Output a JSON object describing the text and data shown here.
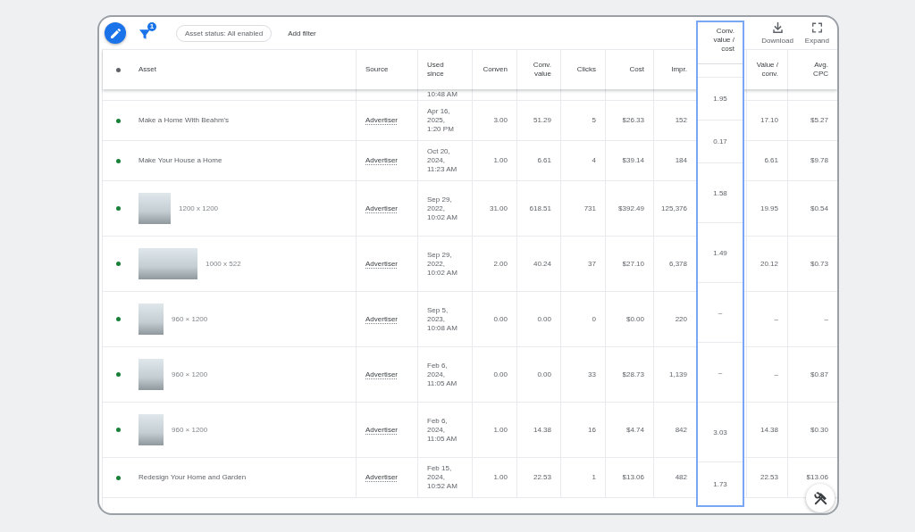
{
  "toolbar": {
    "filter_badge": "1",
    "chips": [
      {
        "label": "Asset status: All enabled"
      }
    ],
    "add_filter": "Add filter",
    "actions": [
      {
        "kind": "download",
        "label": "Download"
      },
      {
        "kind": "expand",
        "label": "Expand"
      }
    ]
  },
  "table": {
    "columns": [
      {
        "kind": "status"
      },
      {
        "kind": "asset",
        "label": "Asset"
      },
      {
        "kind": "source",
        "label": "Source"
      },
      {
        "kind": "date",
        "label": "Used since"
      },
      {
        "kind": "metric",
        "label": "Conven"
      },
      {
        "kind": "metric",
        "label": "Conv. value"
      },
      {
        "kind": "metric",
        "label": "Clicks"
      },
      {
        "kind": "metric",
        "label": "Cost"
      },
      {
        "kind": "metric",
        "label": "Impr."
      },
      {
        "kind": "dragged",
        "label": "Conv. value / cost",
        "values": [
          "1.95",
          "0.17",
          "1.58",
          "1.49",
          "–",
          "–",
          "3.03",
          "1.73"
        ]
      },
      {
        "kind": "metric",
        "label": "Value / conv."
      },
      {
        "kind": "metric",
        "label": "Avg. CPC"
      }
    ],
    "clipped_row": {
      "used_since": "10:48 AM"
    },
    "rows": [
      {
        "color": "#188038",
        "asset": {
          "kind": "text",
          "label": "Make a Home With Beahm's"
        },
        "source": "Advertiser",
        "used_since": "Apr 16, 2025, 1:20 PM",
        "metrics": [
          "3.00",
          "51.29",
          "5",
          "$26.33",
          "152",
          "17.10",
          "$5.27"
        ]
      },
      {
        "color": "#188038",
        "asset": {
          "kind": "text",
          "label": "Make Your House a Home"
        },
        "source": "Advertiser",
        "used_since": "Oct 20, 2024, 11:23 AM",
        "metrics": [
          "1.00",
          "6.61",
          "4",
          "$39.14",
          "184",
          "6.61",
          "$9.78"
        ]
      },
      {
        "color": "#188038",
        "asset": {
          "kind": "square",
          "label": "1200 x 1200"
        },
        "source": "Advertiser",
        "used_since": "Sep 29, 2022, 10:02 AM",
        "metrics": [
          "31.00",
          "618.51",
          "731",
          "$392.49",
          "125,376",
          "19.95",
          "$0.54"
        ]
      },
      {
        "color": "#188038",
        "asset": {
          "kind": "landscape",
          "label": "1000 x 522"
        },
        "source": "Advertiser",
        "used_since": "Sep 29, 2022, 10:02 AM",
        "metrics": [
          "2.00",
          "40.24",
          "37",
          "$27.10",
          "6,378",
          "20.12",
          "$0.73"
        ]
      },
      {
        "color": "#188038",
        "asset": {
          "kind": "portrait",
          "label": "960 × 1200"
        },
        "source": "Advertiser",
        "used_since": "Sep 5, 2023, 10:08 AM",
        "metrics": [
          "0.00",
          "0.00",
          "0",
          "$0.00",
          "220",
          "–",
          "–"
        ]
      },
      {
        "color": "#188038",
        "asset": {
          "kind": "portrait",
          "label": "960 × 1200"
        },
        "source": "Advertiser",
        "used_since": "Feb 6, 2024, 11:05 AM",
        "metrics": [
          "0.00",
          "0.00",
          "33",
          "$28.73",
          "1,139",
          "–",
          "$0.87"
        ]
      },
      {
        "color": "#188038",
        "asset": {
          "kind": "portrait",
          "label": "960 × 1200"
        },
        "source": "Advertiser",
        "used_since": "Feb 6, 2024, 11:05 AM",
        "metrics": [
          "1.00",
          "14.38",
          "16",
          "$4.74",
          "842",
          "14.38",
          "$0.30"
        ]
      },
      {
        "color": "#188038",
        "asset": {
          "kind": "text",
          "label": "Redesign Your Home and Garden"
        },
        "source": "Advertiser",
        "used_since": "Feb 15, 2024, 10:52 AM",
        "metrics": [
          "1.00",
          "22.53",
          "1",
          "$13.06",
          "482",
          "22.53",
          "$13.06"
        ]
      }
    ]
  }
}
